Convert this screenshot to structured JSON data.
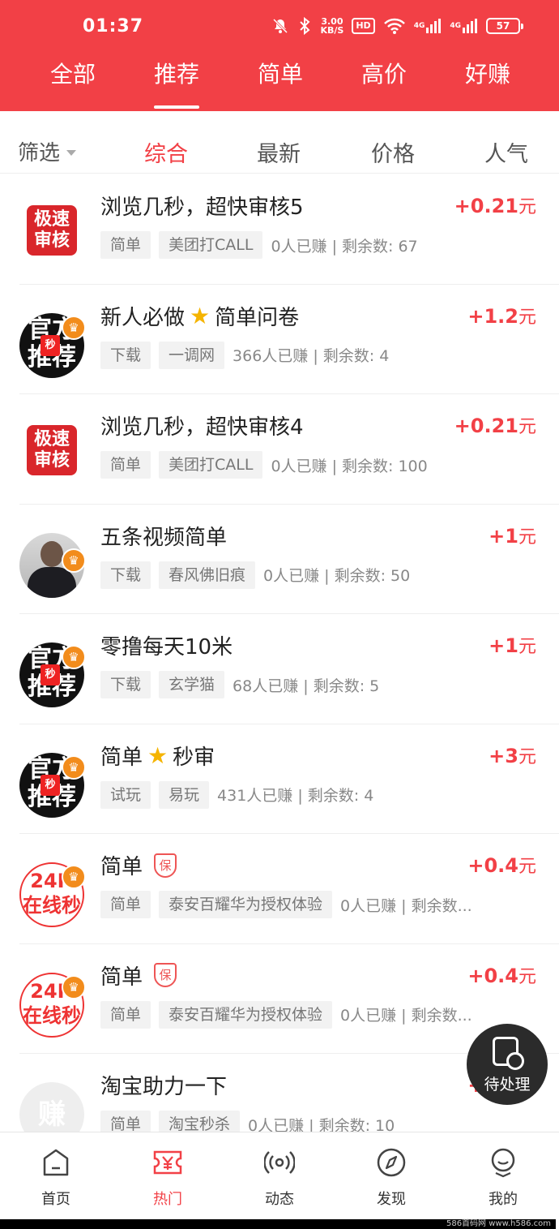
{
  "status": {
    "time": "01:37",
    "speed_top": "3.00",
    "speed_bottom": "KB/S",
    "hd": "HD",
    "net1": "4G",
    "net2": "4G",
    "battery": "57"
  },
  "tabs": [
    {
      "label": "全部"
    },
    {
      "label": "推荐"
    },
    {
      "label": "简单"
    },
    {
      "label": "高价"
    },
    {
      "label": "好赚"
    }
  ],
  "filter": {
    "label": "筛选",
    "sorts": [
      "综合",
      "最新",
      "价格",
      "人气"
    ]
  },
  "tasks": [
    {
      "avatar": "fast",
      "avatar_text": "极速审核",
      "title": "浏览几秒，超快审核5",
      "price": "+0.21",
      "unit": "元",
      "tag1": "简单",
      "tag2": "美团打CALL",
      "stats": "0人已赚 | 剩余数: 67"
    },
    {
      "avatar": "official",
      "avatar_text": "官方推荐",
      "badge": "秒",
      "title_a": "新人必做",
      "title_b": "简单问卷",
      "price": "+1.2",
      "unit": "元",
      "tag1": "下载",
      "tag2": "一调网",
      "stats": "366人已赚 | 剩余数: 4"
    },
    {
      "avatar": "fast",
      "avatar_text": "极速审核",
      "title": "浏览几秒，超快审核4",
      "price": "+0.21",
      "unit": "元",
      "tag1": "简单",
      "tag2": "美团打CALL",
      "stats": "0人已赚 | 剩余数: 100"
    },
    {
      "avatar": "person",
      "title": "五条视频简单",
      "price": "+1",
      "unit": "元",
      "tag1": "下载",
      "tag2": "春风佛旧痕",
      "stats": "0人已赚 | 剩余数: 50"
    },
    {
      "avatar": "official",
      "avatar_text": "官方推荐",
      "badge": "秒",
      "title": "零撸每天10米",
      "price": "+1",
      "unit": "元",
      "tag1": "下载",
      "tag2": "玄学猫",
      "stats": "68人已赚 | 剩余数: 5"
    },
    {
      "avatar": "official",
      "avatar_text": "官方推荐",
      "badge": "秒",
      "title_a": "简单",
      "title_b": "秒审",
      "price": "+3",
      "unit": "元",
      "tag1": "试玩",
      "tag2": "易玩",
      "stats": "431人已赚 | 剩余数: 4"
    },
    {
      "avatar": "24h",
      "avatar_text": "24H在线秒",
      "title": "简单",
      "bao": "保",
      "price": "+0.4",
      "unit": "元",
      "tag1": "简单",
      "tag2": "泰安百耀华为授权体验",
      "stats": "0人已赚 | 剩余数..."
    },
    {
      "avatar": "24h",
      "avatar_text": "24H在线秒",
      "title": "简单",
      "bao": "保",
      "price": "+0.4",
      "unit": "元",
      "tag1": "简单",
      "tag2": "泰安百耀华为授权体验",
      "stats": "0人已赚 | 剩余数..."
    },
    {
      "avatar": "placeholder",
      "avatar_text": "赚",
      "title": "淘宝助力一下",
      "price": "+0.4",
      "unit": "元",
      "tag1": "简单",
      "tag2": "淘宝秒杀",
      "stats": "0人已赚 | 剩余数: 10"
    }
  ],
  "fab": {
    "label": "待处理"
  },
  "nav": [
    {
      "label": "首页",
      "icon": "home-icon"
    },
    {
      "label": "热门",
      "icon": "hot-ticket-icon"
    },
    {
      "label": "动态",
      "icon": "broadcast-icon"
    },
    {
      "label": "发现",
      "icon": "compass-icon"
    },
    {
      "label": "我的",
      "icon": "profile-icon"
    }
  ],
  "watermark": "586首码网 www.h586.com"
}
